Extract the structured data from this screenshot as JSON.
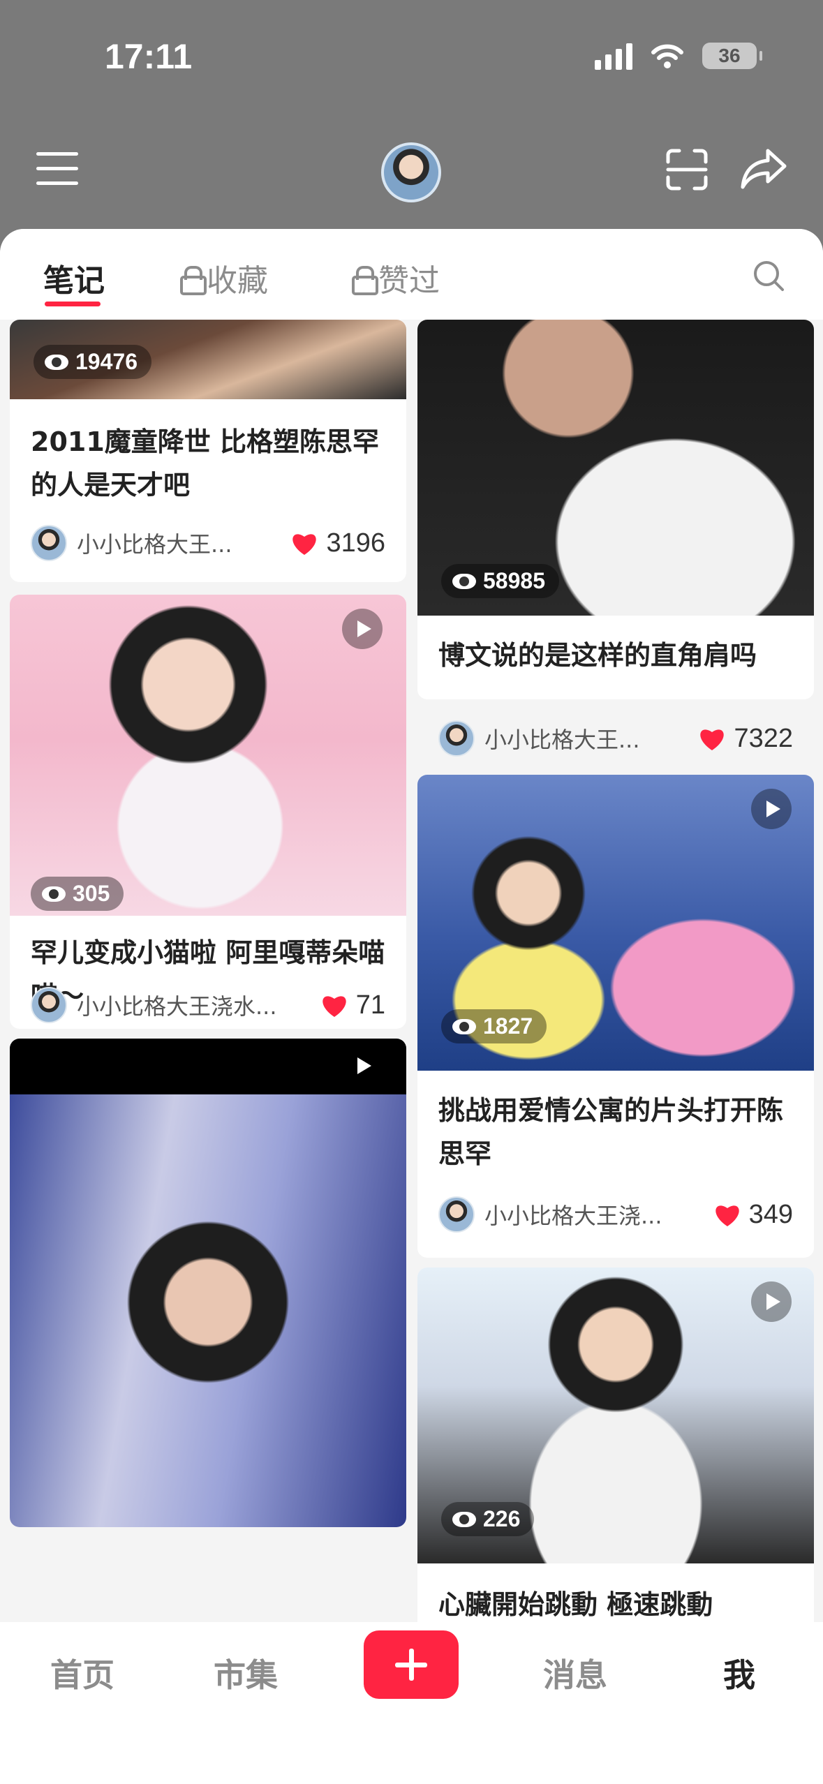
{
  "status": {
    "time": "17:11",
    "battery": "36"
  },
  "tabs": [
    {
      "label": "笔记"
    },
    {
      "label": "收藏"
    },
    {
      "label": "赞过"
    }
  ],
  "feed": {
    "left": [
      {
        "views": "19476",
        "title": "2011魔童降世 比格塑陈思罕的人是天才吧",
        "author": "小小比格大王...",
        "likes": "3196"
      },
      {
        "views": "305",
        "title": "罕儿变成小猫啦 阿里嘎蒂朵喵喵～",
        "author": "小小比格大王浇水...",
        "likes": "71"
      },
      {
        "views": "",
        "title": "",
        "author": "",
        "likes": ""
      }
    ],
    "right": [
      {
        "views": "58985",
        "title": "博文说的是这样的直角肩吗",
        "author": "小小比格大王...",
        "likes": "7322"
      },
      {
        "views": "1827",
        "title": "挑战用爱情公寓的片头打开陈思罕",
        "author": "小小比格大王浇...",
        "likes": "349"
      },
      {
        "views": "226",
        "title": "心臟開始跳動 極速跳動",
        "author": "",
        "likes": ""
      }
    ]
  },
  "nav": {
    "home": "首页",
    "market": "市集",
    "messages": "消息",
    "me": "我"
  },
  "colors": {
    "accent": "#ff2442",
    "header_bg": "#7a7a7a"
  },
  "icons": [
    "menu-icon",
    "scan-icon",
    "share-icon",
    "search-icon",
    "lock-icon",
    "eye-icon",
    "heart-icon",
    "play-icon",
    "plus-icon"
  ]
}
